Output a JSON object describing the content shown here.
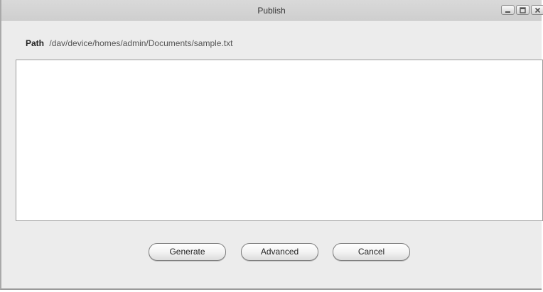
{
  "window": {
    "title": "Publish",
    "controls": [
      "minimize-icon",
      "maximize-icon",
      "close-icon"
    ]
  },
  "path": {
    "label": "Path",
    "value": "/dav/device/homes/admin/Documents/sample.txt"
  },
  "textarea": {
    "value": ""
  },
  "buttons": {
    "generate": "Generate",
    "advanced": "Advanced",
    "cancel": "Cancel"
  },
  "colors": {
    "window_bg": "#ececec",
    "titlebar_bg": "#d4d4d4",
    "textarea_bg": "#ffffff",
    "text": "#333333"
  }
}
